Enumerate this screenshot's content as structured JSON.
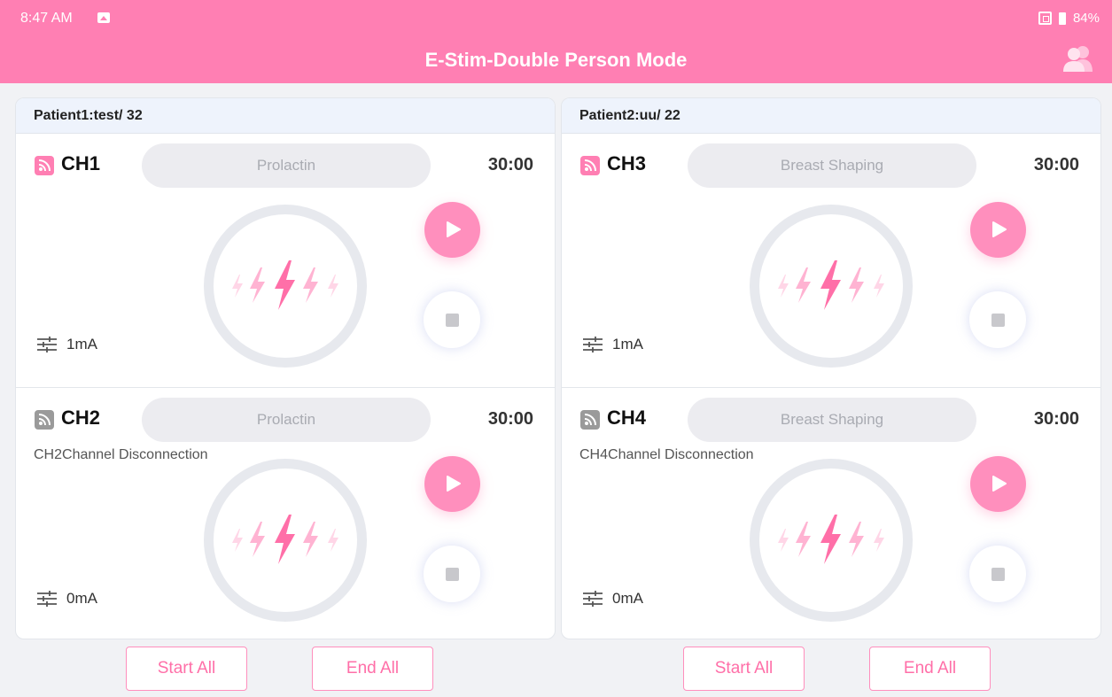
{
  "status_bar": {
    "time": "8:47 AM",
    "battery": "84%"
  },
  "header": {
    "title": "E-Stim-Double Person Mode"
  },
  "patients": [
    {
      "label": "Patient1:test/ 32",
      "channels": [
        {
          "name": "CH1",
          "mode": "Prolactin",
          "time": "30:00",
          "message": "",
          "current": "1mA",
          "connected": true
        },
        {
          "name": "CH2",
          "mode": "Prolactin",
          "time": "30:00",
          "message": "CH2Channel Disconnection",
          "current": "0mA",
          "connected": false
        }
      ],
      "start_all": "Start All",
      "end_all": "End All"
    },
    {
      "label": "Patient2:uu/ 22",
      "channels": [
        {
          "name": "CH3",
          "mode": "Breast Shaping",
          "time": "30:00",
          "message": "",
          "current": "1mA",
          "connected": true
        },
        {
          "name": "CH4",
          "mode": "Breast Shaping",
          "time": "30:00",
          "message": "CH4Channel Disconnection",
          "current": "0mA",
          "connected": false
        }
      ],
      "start_all": "Start All",
      "end_all": "End All"
    }
  ],
  "colors": {
    "accent": "#ff7fb3",
    "disconnected": "#9a9a9a",
    "panel_head": "#eef3fc"
  },
  "icons": [
    "image-icon",
    "vibrate-icon",
    "battery-icon",
    "users-icon",
    "signal-icon",
    "lightning-icon",
    "play-icon",
    "stop-icon",
    "sliders-icon"
  ]
}
